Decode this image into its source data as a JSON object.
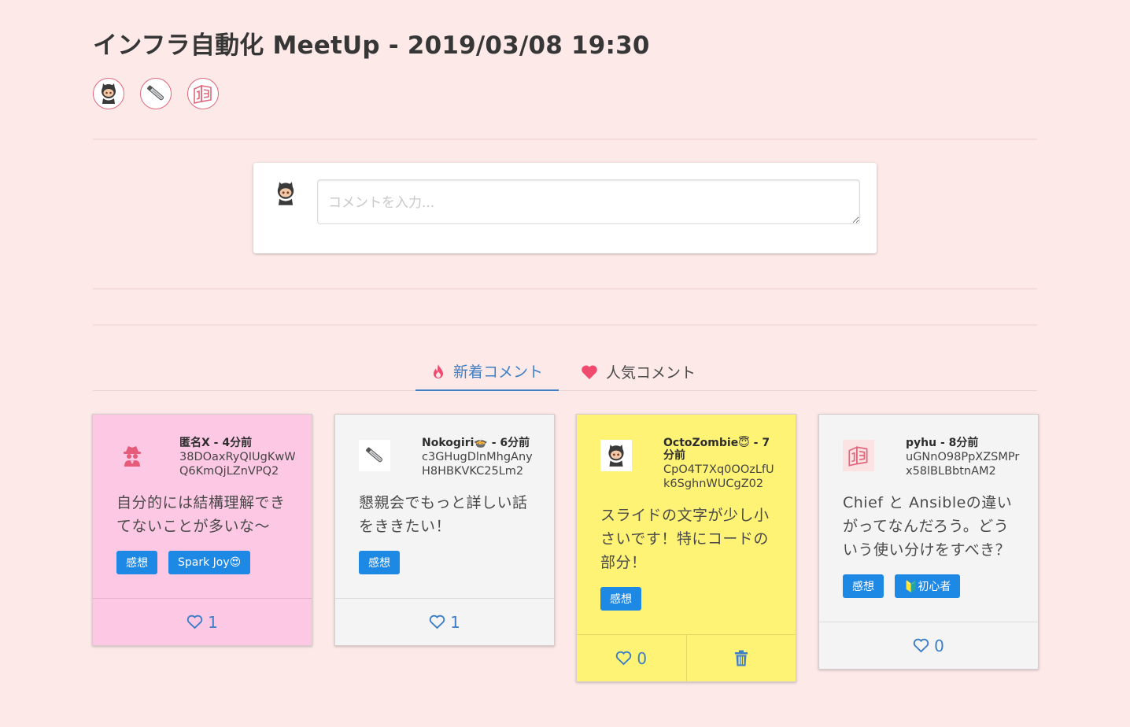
{
  "page": {
    "title": "インフラ自動化 MeetUp - 2019/03/08 19:30"
  },
  "members": [
    {
      "icon": "octocat-icon"
    },
    {
      "icon": "nokogiri-icon"
    },
    {
      "icon": "pyhu-logo-icon"
    }
  ],
  "composer": {
    "placeholder": "コメントを入力..."
  },
  "tabs": {
    "new_label": "新着コメント",
    "popular_label": "人気コメント"
  },
  "colors": {
    "background": "#fce9e8",
    "accent": "#3e7ec6",
    "tag": "#1e88e5",
    "card_pink": "#fdc8e4",
    "card_gray": "#f4f4f4",
    "card_yellow": "#fef374",
    "tab_fire": "#f04a6e",
    "delete": "#3e7ec6"
  },
  "comments": [
    {
      "author": "匿名X - 4分前",
      "uid": "38DOaxRyQIUgKwWQ6KmQjLZnVPQ2",
      "body": "自分的には結構理解できてないことが多いな〜",
      "tags": [
        "感想",
        "Spark Joy😍"
      ],
      "likes": "1",
      "icon": "anonymous-spy-icon"
    },
    {
      "author": "Nokogiri🍲 - 6分前",
      "uid": "c3GHugDlnMhgAnyH8HBKVKC25Lm2",
      "body": "懇親会でもっと詳しい話をききたい！",
      "tags": [
        "感想"
      ],
      "likes": "1",
      "icon": "nokogiri-icon"
    },
    {
      "author": "OctoZombie😇 - 7分前",
      "uid": "CpO4T7Xq0OOzLfUk6SghnWUCgZ02",
      "body": "スライドの文字が少し小さいです！特にコードの部分！",
      "tags": [
        "感想"
      ],
      "likes": "0",
      "icon": "octocat-icon"
    },
    {
      "author": "pyhu - 8分前",
      "uid": "uGNnO98PpXZSMPrx58lBLBbtnAM2",
      "body": "Chief と Ansibleの違いがってなんだろう。どういう使い分けをすべき？",
      "tags": [
        "感想",
        "🔰初心者"
      ],
      "likes": "0",
      "icon": "pyhu-logo-icon"
    }
  ]
}
